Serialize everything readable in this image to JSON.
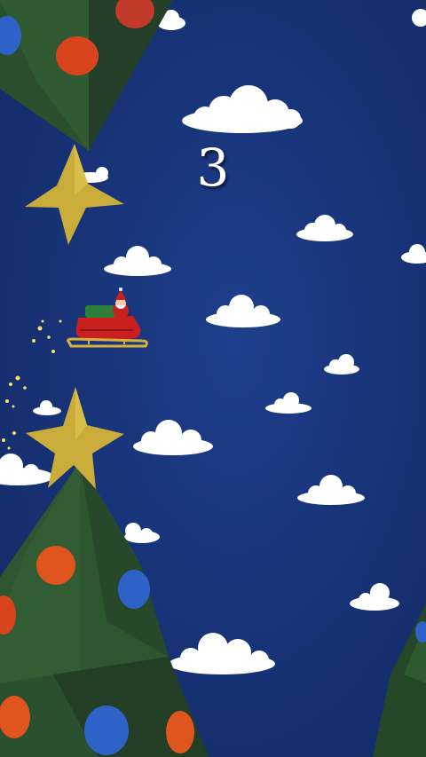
{
  "game": {
    "score": "3"
  },
  "palette": {
    "sky": "#183479",
    "cloud": "#ffffff",
    "tree": "#2e5a32",
    "star": "#c9ac3a",
    "ornament_red": "#d8451c",
    "ornament_blue": "#2f62c8",
    "sleigh": "#c91f1f",
    "sparkle": "#f7e06a"
  },
  "sprites": {
    "player": "santa-sleigh",
    "obstacles": [
      "christmas-tree-top",
      "christmas-tree-bottom"
    ],
    "background": [
      "cloud",
      "cloud",
      "cloud"
    ]
  }
}
